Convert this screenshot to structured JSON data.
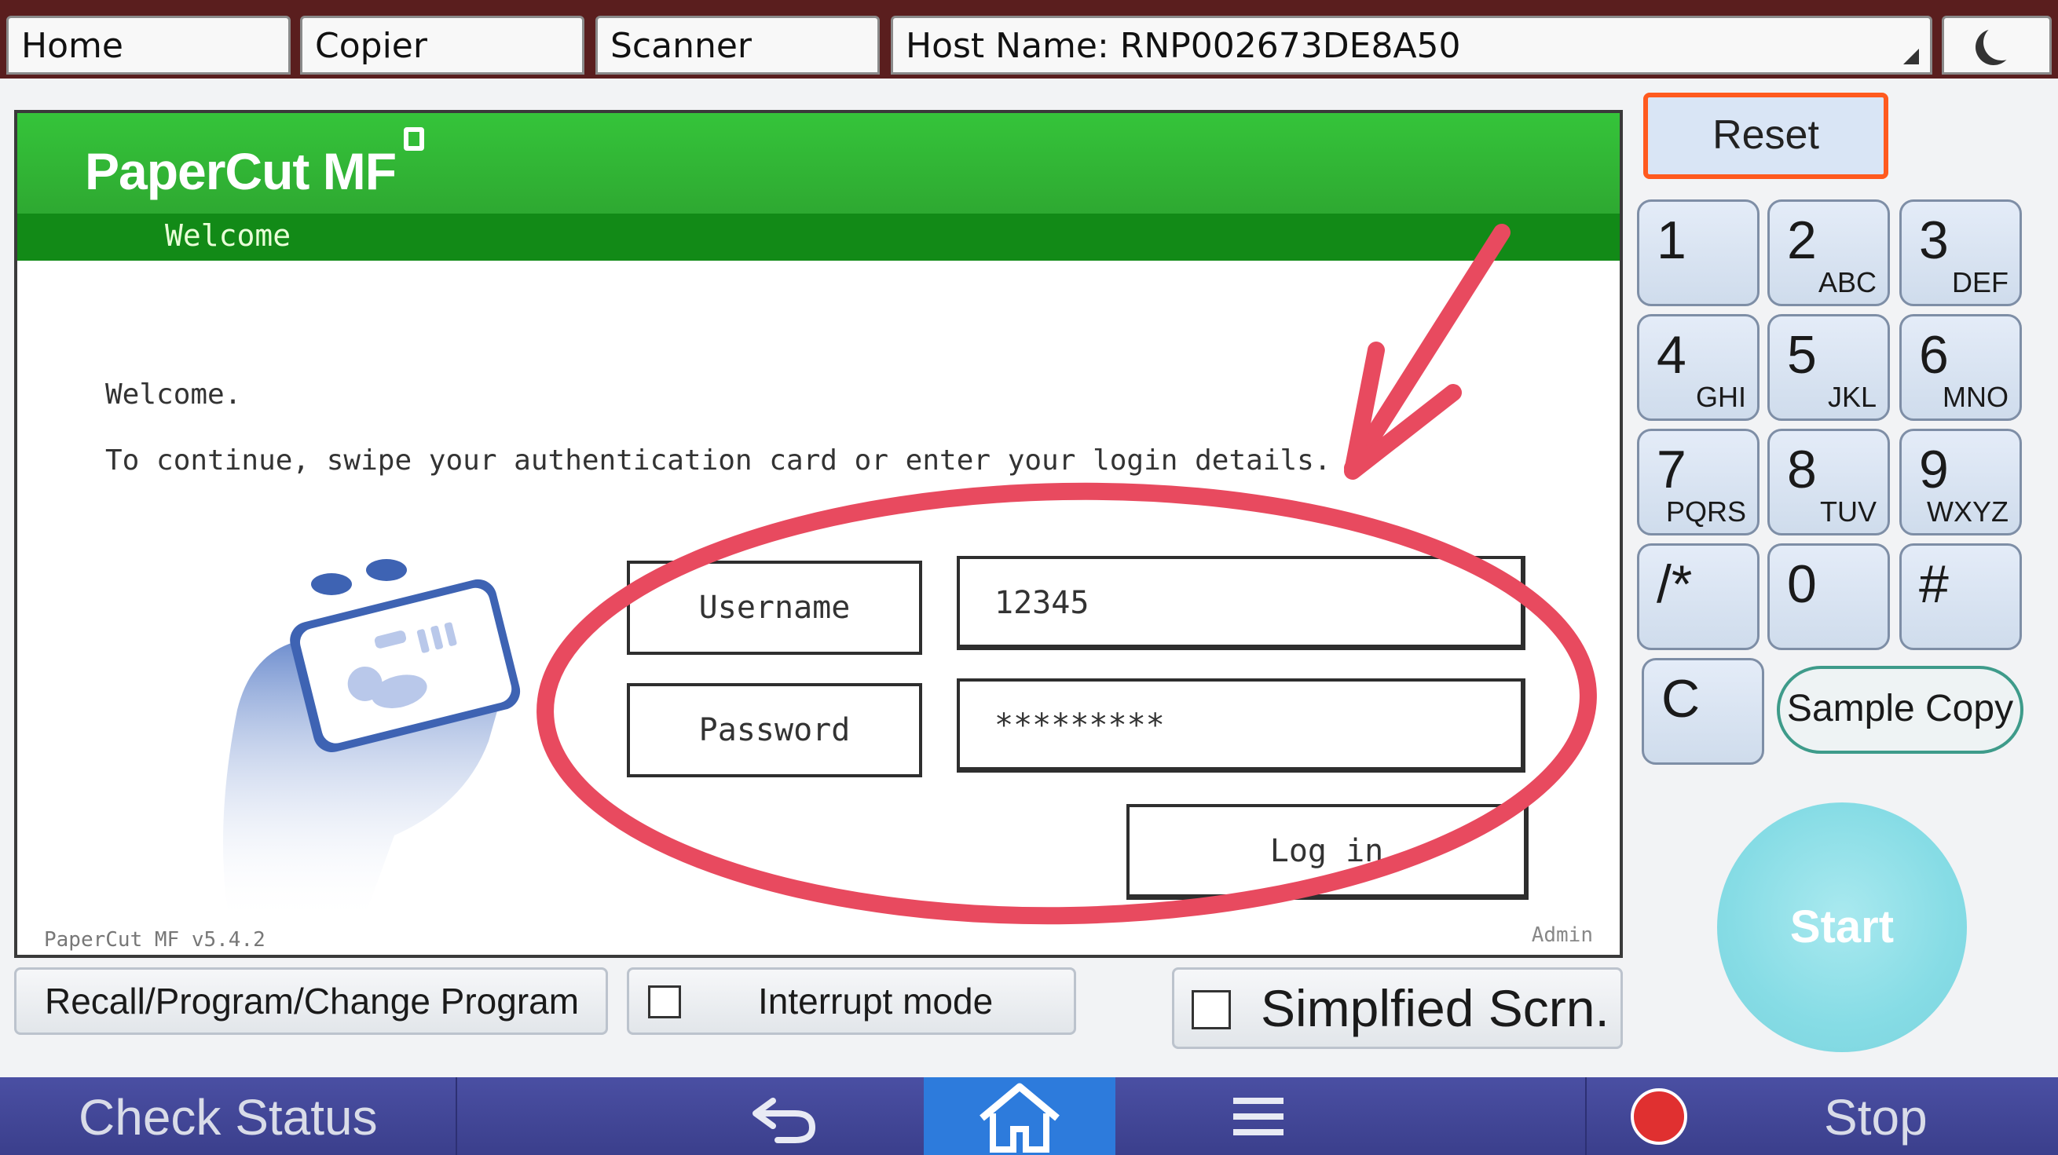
{
  "topbar": {
    "home_tab": "Home",
    "copier_tab": "Copier",
    "scanner_tab": "Scanner",
    "host_name": "Host Name: RNP002673DE8A50"
  },
  "panel": {
    "logo": "PaperCut MF",
    "header_welcome": "Welcome",
    "welcome": "Welcome.",
    "instructions": "To continue, swipe your authentication card or enter your login details.",
    "username_label": "Username",
    "username_value": "12345",
    "password_label": "Password",
    "password_value": "*********",
    "login_button": "Log in",
    "version": "PaperCut MF v5.4.2",
    "admin": "Admin"
  },
  "keypad": {
    "reset": "Reset",
    "keys": [
      {
        "num": "1",
        "letters": ""
      },
      {
        "num": "2",
        "letters": "ABC"
      },
      {
        "num": "3",
        "letters": "DEF"
      },
      {
        "num": "4",
        "letters": "GHI"
      },
      {
        "num": "5",
        "letters": "JKL"
      },
      {
        "num": "6",
        "letters": "MNO"
      },
      {
        "num": "7",
        "letters": "PQRS"
      },
      {
        "num": "8",
        "letters": "TUV"
      },
      {
        "num": "9",
        "letters": "WXYZ"
      },
      {
        "num": "/*",
        "letters": ""
      },
      {
        "num": "0",
        "letters": ""
      },
      {
        "num": "#",
        "letters": ""
      },
      {
        "num": "C",
        "letters": ""
      }
    ],
    "sample_copy": "Sample Copy",
    "start": "Start"
  },
  "bottom": {
    "recall": "Recall/Program/Change Program",
    "interrupt": "Interrupt mode",
    "simplified": "Simplfied Scrn."
  },
  "navbar": {
    "check_status": "Check Status",
    "stop": "Stop"
  },
  "colors": {
    "papercut_green": "#2ea831",
    "annotation_red": "#e84a5f",
    "reset_border": "#ff5a1f",
    "start_cyan": "#86dce5",
    "navbar_blue": "#3b3f8c",
    "home_highlight": "#2d7bdc"
  },
  "icons": {
    "moon": "moon-icon",
    "back": "back-arrow-icon",
    "home": "home-icon",
    "menu": "menu-icon",
    "stop": "stop-icon"
  }
}
